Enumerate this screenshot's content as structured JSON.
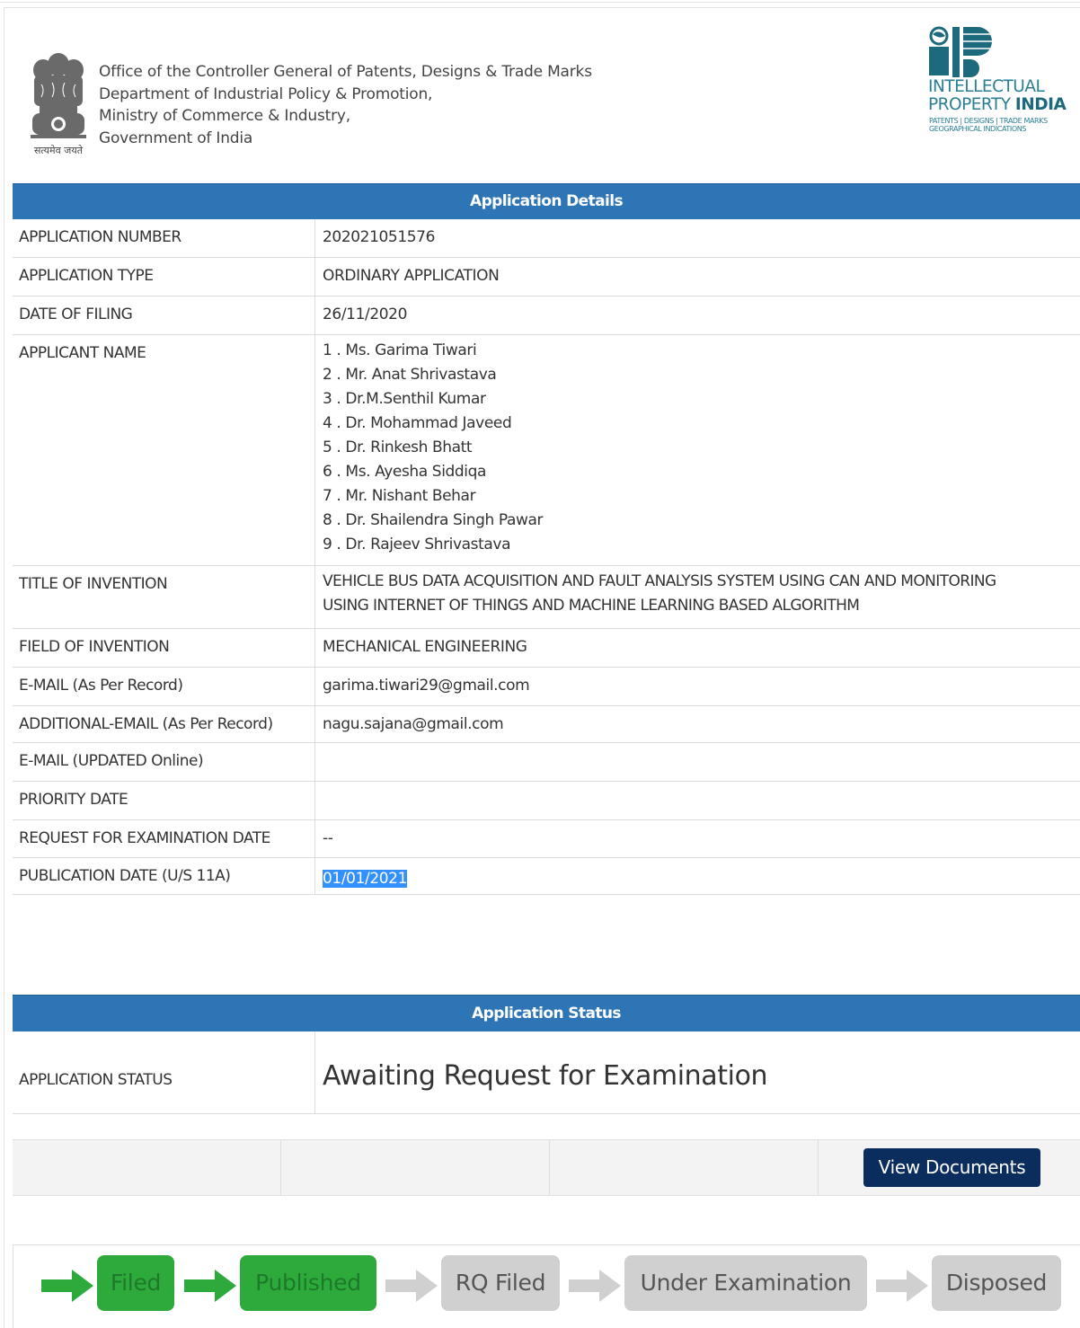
{
  "header": {
    "office_lines": [
      "Office of the Controller General of Patents, Designs & Trade Marks",
      "Department of Industrial Policy & Promotion,",
      "Ministry of Commerce & Industry,",
      "Government of India"
    ],
    "emblem_caption": "सत्यमेव जयते",
    "ip_logo": {
      "line1": "INTELLECTUAL",
      "line2_prefix": "PROPERTY ",
      "line2_bold": "INDIA",
      "line3": "PATENTS | DESIGNS | TRADE MARKS",
      "line4": "GEOGRAPHICAL INDICATIONS"
    }
  },
  "details": {
    "heading": "Application Details",
    "application_number": {
      "label": "APPLICATION NUMBER",
      "value": "202021051576"
    },
    "application_type": {
      "label": "APPLICATION TYPE",
      "value": "ORDINARY APPLICATION"
    },
    "date_of_filing": {
      "label": "DATE OF FILING",
      "value": "26/11/2020"
    },
    "applicant_name": {
      "label": "APPLICANT NAME",
      "values": [
        "1 . Ms. Garima Tiwari",
        "2 . Mr. Anat Shrivastava",
        "3 . Dr.M.Senthil Kumar",
        "4 . Dr. Mohammad Javeed",
        "5 . Dr. Rinkesh Bhatt",
        "6 . Ms. Ayesha Siddiqa",
        "7 . Mr. Nishant Behar",
        "8 . Dr. Shailendra Singh Pawar",
        "9 . Dr. Rajeev Shrivastava"
      ]
    },
    "title_of_invention": {
      "label": "TITLE OF INVENTION",
      "line1": "VEHICLE BUS DATA ACQUISITION AND FAULT ANALYSIS SYSTEM USING CAN AND MONITORING",
      "line2": "USING INTERNET OF THINGS AND MACHINE LEARNING BASED ALGORITHM"
    },
    "field_of_invention": {
      "label": "FIELD OF INVENTION",
      "value": "MECHANICAL ENGINEERING"
    },
    "email": {
      "label": "E-MAIL (As Per Record)",
      "value": "garima.tiwari29@gmail.com"
    },
    "additional_email": {
      "label": "ADDITIONAL-EMAIL (As Per Record)",
      "value": "nagu.sajana@gmail.com"
    },
    "email_updated": {
      "label": "E-MAIL (UPDATED Online)",
      "value": ""
    },
    "priority_date": {
      "label": "PRIORITY DATE",
      "value": ""
    },
    "request_exam_date": {
      "label": "REQUEST FOR EXAMINATION DATE",
      "value": "--"
    },
    "publication_date": {
      "label": "PUBLICATION DATE (U/S 11A)",
      "value": "01/01/2021"
    }
  },
  "status": {
    "heading": "Application Status",
    "label": "APPLICATION STATUS",
    "value": "Awaiting Request for Examination",
    "view_documents_label": "View Documents"
  },
  "progress": {
    "stages": [
      {
        "label": "Filed",
        "done": true
      },
      {
        "label": "Published",
        "done": true
      },
      {
        "label": "RQ Filed",
        "done": false
      },
      {
        "label": "Under Examination",
        "done": false
      },
      {
        "label": "Disposed",
        "done": false
      }
    ]
  },
  "colors": {
    "header_bar": "#2e75b6",
    "button": "#0b2d5e",
    "stage_done": "#2eaa3c",
    "stage_todo": "#d0d0d0",
    "arrow_done": "#2eaa3c",
    "arrow_todo": "#d0d0d0"
  }
}
